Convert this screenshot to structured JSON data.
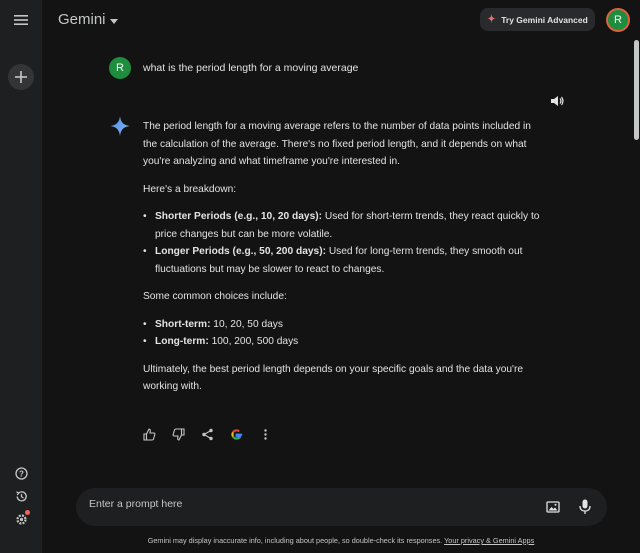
{
  "header": {
    "app_title": "Gemini",
    "try_advanced_label": "Try Gemini Advanced",
    "avatar_initial": "R"
  },
  "conversation": {
    "user_initial": "R",
    "user_message": "what is the period length for a moving average",
    "response": {
      "intro": "The period length for a moving average refers to the number of data points included in the calculation of the average. There's no fixed period length, and it depends on what you're analyzing and what timeframe you're interested in.",
      "breakdown_heading": "Here's a breakdown:",
      "breakdown": [
        {
          "term": "Shorter Periods (e.g., 10, 20 days):",
          "text": " Used for short-term trends, they react quickly to price changes but can be more volatile."
        },
        {
          "term": "Longer Periods (e.g., 50, 200 days):",
          "text": " Used for long-term trends, they smooth out fluctuations but may be slower to react to changes."
        }
      ],
      "choices_heading": "Some common choices include:",
      "choices": [
        {
          "term": "Short-term:",
          "text": " 10, 20, 50 days"
        },
        {
          "term": "Long-term:",
          "text": " 100, 200, 500 days"
        }
      ],
      "conclusion": "Ultimately, the best period length depends on your specific goals and the data you're working with."
    }
  },
  "prompt": {
    "placeholder": "Enter a prompt here"
  },
  "footer": {
    "disclaimer": "Gemini may display inaccurate info, including about people, so double-check its responses.",
    "link_text": "Your privacy & Gemini Apps"
  },
  "colors": {
    "background": "#131314",
    "sidebar": "#1e1f20",
    "avatar": "#1e8e3e",
    "accent_star": "#4a90e2"
  }
}
